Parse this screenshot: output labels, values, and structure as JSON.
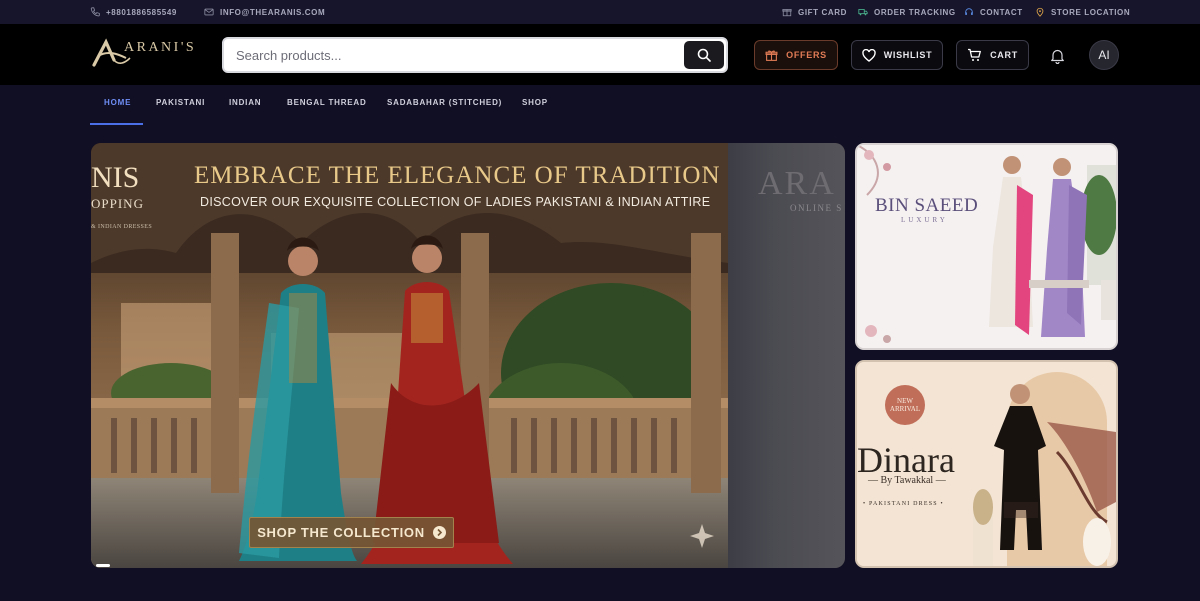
{
  "topbar": {
    "phone": "+8801886585549",
    "email": "INFO@THEARANIS.COM",
    "links": [
      {
        "label": "GIFT CARD",
        "icon": "gift-icon"
      },
      {
        "label": "ORDER TRACKING",
        "icon": "truck-icon"
      },
      {
        "label": "CONTACT",
        "icon": "headset-icon"
      },
      {
        "label": "STORE LOCATION",
        "icon": "location-pin-icon"
      }
    ]
  },
  "header": {
    "logo_text": "ARANI'S",
    "search": {
      "placeholder": "Search products..."
    },
    "offers_label": "OFFERS",
    "wishlist_label": "WISHLIST",
    "cart_label": "CART",
    "avatar_initials": "AI"
  },
  "nav": {
    "items": [
      "HOME",
      "PAKISTANI",
      "INDIAN",
      "BENGAL THREAD",
      "SADABAHAR (STITCHED)",
      "SHOP"
    ],
    "active": "HOME"
  },
  "hero": {
    "brand_partial": "NIS",
    "brand_sub_partial": "OPPING",
    "brand_tiny": "& INDIAN DRESSES",
    "title": "EMBRACE THE ELEGANCE OF TRADITION",
    "subtitle": "DISCOVER OUR EXQUISITE COLLECTION OF LADIES PAKISTANI & INDIAN ATTIRE",
    "cta_label": "SHOP THE COLLECTION",
    "next_slide_text": "ARA",
    "next_slide_sub": "ONLINE S"
  },
  "banners": {
    "bin_saeed": {
      "brand": "BIN SAEED",
      "sub": "LUXURY"
    },
    "dinara": {
      "badge_line1": "NEW",
      "badge_line2": "ARRIVAL",
      "title": "Dinara",
      "by": "— By Tawakkal —",
      "category": "• PAKISTANI DRESS •"
    }
  },
  "colors": {
    "page_bg": "#100f24",
    "header_bg": "#000000",
    "nav_active": "#6f8ef5",
    "offers_accent": "#e27c56",
    "hero_title": "#e8c98a"
  }
}
